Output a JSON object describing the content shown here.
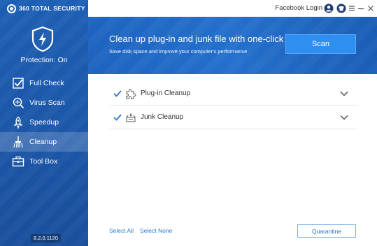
{
  "app": {
    "brand": "360 TOTAL SECURITY",
    "version": "8.2.0.1120"
  },
  "sidebar": {
    "protection_status": "Protection: On",
    "items": [
      {
        "label": "Full Check",
        "icon": "checklist-icon"
      },
      {
        "label": "Virus Scan",
        "icon": "virus-scan-icon"
      },
      {
        "label": "Speedup",
        "icon": "rocket-icon"
      },
      {
        "label": "Cleanup",
        "icon": "broom-icon",
        "active": true
      },
      {
        "label": "Tool Box",
        "icon": "toolbox-icon"
      }
    ]
  },
  "titlebar": {
    "login_text": "Facebook Login",
    "icons": [
      "user-icon",
      "shirt-icon",
      "menu-icon",
      "minimize-icon",
      "close-icon"
    ]
  },
  "banner": {
    "title": "Clean up plug-in and junk file with one-click",
    "subtitle": "Save disk space and improve your computer's performance",
    "scan_label": "Scan"
  },
  "cleanup": {
    "items": [
      {
        "label": "Plug-in Cleanup",
        "checked": true,
        "icon": "puzzle-icon"
      },
      {
        "label": "Junk Cleanup",
        "checked": true,
        "icon": "junk-tray-icon"
      }
    ],
    "select_all": "Select All",
    "select_none": "Select None",
    "quarantine": "Quarantine"
  },
  "colors": {
    "sidebar": "#1d5fb5",
    "banner": "#2470cc",
    "scan_button": "#2e8ff0",
    "link": "#2a7ad6",
    "check": "#2a7ad6"
  }
}
